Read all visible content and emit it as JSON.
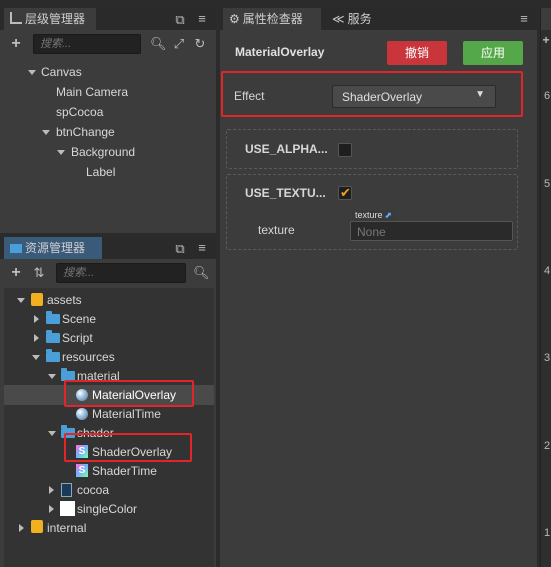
{
  "hierarchy": {
    "tab_label": "层级管理器",
    "search_placeholder": "搜索...",
    "nodes": [
      "Canvas",
      "Main Camera",
      "spCocoa",
      "btnChange",
      "Background",
      "Label"
    ]
  },
  "assets": {
    "tab_label": "资源管理器",
    "search_placeholder": "搜索...",
    "items": [
      "assets",
      "Scene",
      "Script",
      "resources",
      "material",
      "MaterialOverlay",
      "MaterialTime",
      "shader",
      "ShaderOverlay",
      "ShaderTime",
      "cocoa",
      "singleColor",
      "internal"
    ]
  },
  "inspector": {
    "tab_label": "属性检查器",
    "service_tab_label": "服务",
    "title": "MaterialOverlay",
    "revert_label": "撤销",
    "apply_label": "应用",
    "effect_label": "Effect",
    "effect_value": "ShaderOverlay",
    "use_alpha_label": "USE_ALPHA...",
    "use_alpha_checked": false,
    "use_texture_label": "USE_TEXTU...",
    "use_texture_checked": true,
    "texture_label": "texture",
    "texture_tag": "texture",
    "texture_value": "None"
  },
  "scene_ruler": {
    "ticks": [
      "6",
      "5",
      "4",
      "3",
      "2",
      "1"
    ]
  },
  "colors": {
    "highlight": "#e0262a",
    "revert": "#c9353b",
    "apply": "#55a84a",
    "accent_check": "#f0a020"
  }
}
